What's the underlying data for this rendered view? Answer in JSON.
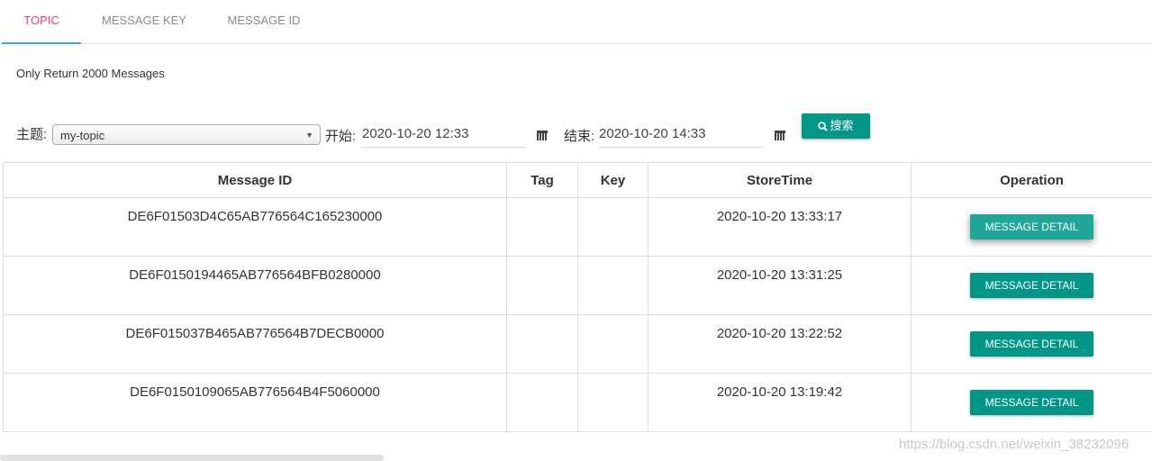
{
  "tabs": [
    {
      "label": "TOPIC"
    },
    {
      "label": "MESSAGE KEY"
    },
    {
      "label": "MESSAGE ID"
    }
  ],
  "note": "Only Return 2000 Messages",
  "filters": {
    "topic_label": "主题:",
    "topic_value": "my-topic",
    "start_label": "开始:",
    "start_value": "2020-10-20 12:33",
    "end_label": "结束:",
    "end_value": "2020-10-20 14:33",
    "search_label": "搜索"
  },
  "table": {
    "headers": {
      "message_id": "Message ID",
      "tag": "Tag",
      "key": "Key",
      "store_time": "StoreTime",
      "operation": "Operation"
    },
    "rows": [
      {
        "message_id": "DE6F01503D4C65AB776564C165230000",
        "tag": "",
        "key": "",
        "store_time": "2020-10-20 13:33:17",
        "action": "MESSAGE DETAIL"
      },
      {
        "message_id": "DE6F0150194465AB776564BFB0280000",
        "tag": "",
        "key": "",
        "store_time": "2020-10-20 13:31:25",
        "action": "MESSAGE DETAIL"
      },
      {
        "message_id": "DE6F015037B465AB776564B7DECB0000",
        "tag": "",
        "key": "",
        "store_time": "2020-10-20 13:22:52",
        "action": "MESSAGE DETAIL"
      },
      {
        "message_id": "DE6F0150109065AB776564B4F5060000",
        "tag": "",
        "key": "",
        "store_time": "2020-10-20 13:19:42",
        "action": "MESSAGE DETAIL"
      }
    ]
  },
  "watermark": "https://blog.csdn.net/weixin_38232096",
  "colors": {
    "accent": "#009688",
    "active_tab": "#e5407b",
    "tab_ink": "#3aa5e0"
  }
}
